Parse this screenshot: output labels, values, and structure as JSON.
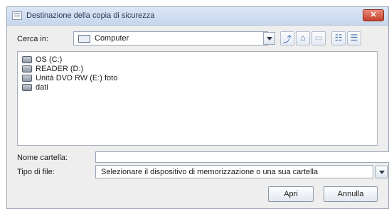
{
  "window": {
    "title": "Destinazione della copia di sicurezza",
    "close_glyph": "✕"
  },
  "lookin": {
    "label": "Cerca in:",
    "value": "Computer",
    "icon": "computer-icon"
  },
  "toolbar": [
    {
      "name": "up-one-level-button",
      "icon": "up-folder-icon",
      "glyph": "⤴",
      "enabled": true
    },
    {
      "name": "home-button",
      "icon": "home-icon",
      "glyph": "⌂",
      "enabled": true
    },
    {
      "name": "new-folder-button",
      "icon": "new-folder-icon",
      "glyph": "▭",
      "enabled": false
    },
    {
      "name": "list-view-button",
      "icon": "list-view-icon",
      "glyph": "☷",
      "enabled": true
    },
    {
      "name": "details-view-button",
      "icon": "details-view-icon",
      "glyph": "☰",
      "enabled": true
    }
  ],
  "files": [
    {
      "label": "OS (C:)",
      "icon": "drive-icon"
    },
    {
      "label": "READER (D:)",
      "icon": "drive-icon"
    },
    {
      "label": "Unità DVD RW (E:) foto",
      "icon": "dvd-drive-icon"
    },
    {
      "label": "dati",
      "icon": "drive-icon"
    }
  ],
  "folder_name": {
    "label": "Nome cartella:",
    "value": ""
  },
  "file_type": {
    "label": "Tipo di file:",
    "value": "Selezionare il dispositivo di memorizzazione o una sua cartella"
  },
  "buttons": {
    "open": "Apri",
    "cancel": "Annulla"
  },
  "colors": {
    "titlebar": "#c6d6ec",
    "close": "#c4402c",
    "accent": "#3b6ea5"
  }
}
